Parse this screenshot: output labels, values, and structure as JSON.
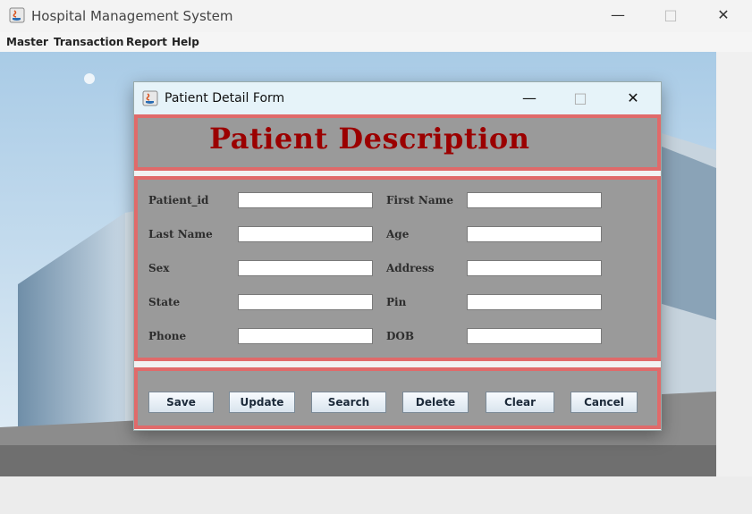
{
  "app": {
    "title": "Hospital Management System"
  },
  "menu": [
    "Master",
    "Transaction",
    "Report",
    "Help"
  ],
  "dialog": {
    "title": "Patient Detail Form",
    "heading": "Patient Description",
    "fields": [
      {
        "label": "Patient_id",
        "value": ""
      },
      {
        "label": "First Name",
        "value": ""
      },
      {
        "label": "Last Name",
        "value": ""
      },
      {
        "label": "Age",
        "value": ""
      },
      {
        "label": "Sex",
        "value": ""
      },
      {
        "label": "Address",
        "value": ""
      },
      {
        "label": "State",
        "value": ""
      },
      {
        "label": "Pin",
        "value": ""
      },
      {
        "label": "Phone",
        "value": ""
      },
      {
        "label": "DOB",
        "value": ""
      }
    ],
    "buttons": [
      "Save",
      "Update",
      "Search",
      "Delete",
      "Clear",
      "Cancel"
    ]
  },
  "colors": {
    "heading": "#9b0000",
    "panel_border": "#e06a6a",
    "panel_bg": "#9a9a9a",
    "title_bar": "#e6f3f9"
  },
  "icons": [
    "java-app-icon",
    "minimize-icon",
    "maximize-icon",
    "close-icon"
  ]
}
